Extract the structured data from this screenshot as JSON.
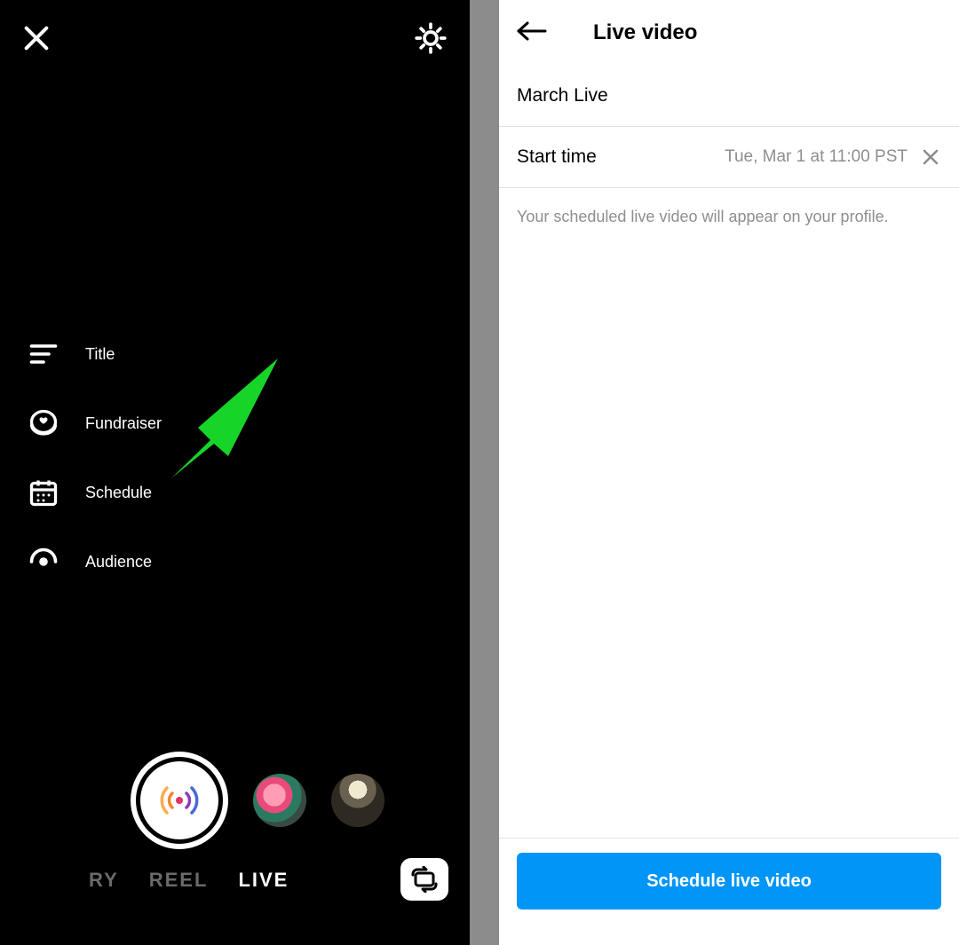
{
  "left": {
    "options": [
      {
        "label": "Title"
      },
      {
        "label": "Fundraiser"
      },
      {
        "label": "Schedule"
      },
      {
        "label": "Audience"
      }
    ],
    "modes": {
      "story_fragment": "RY",
      "reel": "REEL",
      "live": "LIVE"
    }
  },
  "right": {
    "header_title": "Live video",
    "title_row": "March Live",
    "start_time_label": "Start time",
    "start_time_value": "Tue, Mar 1 at 11:00 PST",
    "note": "Your scheduled live video will appear on your profile.",
    "cta": "Schedule live video"
  }
}
